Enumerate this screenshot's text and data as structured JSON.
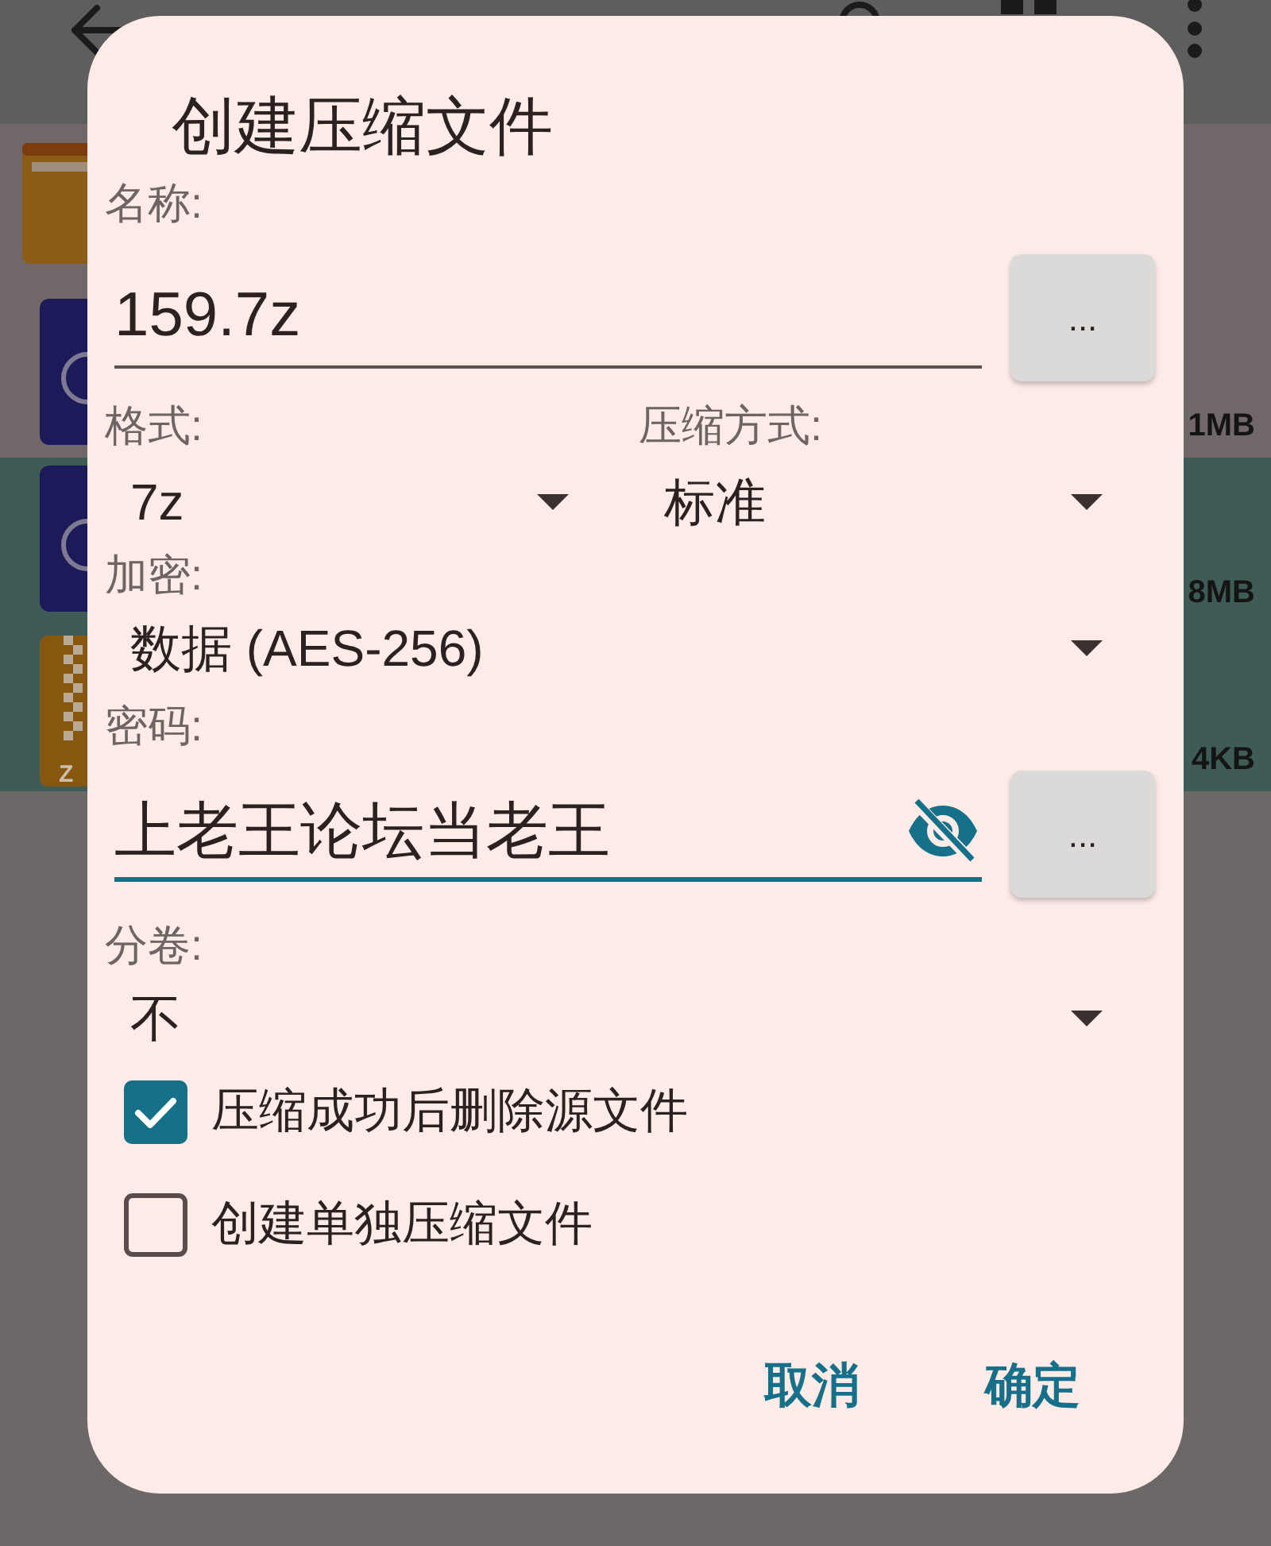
{
  "file_list": [
    {
      "kind": "folder",
      "selected": false
    },
    {
      "kind": "app",
      "size": "1MB",
      "selected": false
    },
    {
      "kind": "app",
      "size": "8MB",
      "selected": true
    },
    {
      "kind": "archive",
      "icon_text": "Z",
      "size": "4KB",
      "selected": true
    }
  ],
  "dialog": {
    "title": "创建压缩文件",
    "rows": [
      {
        "kind": "input",
        "label": "名称:",
        "value": "159.7z",
        "focused": false,
        "button": "..."
      },
      {
        "kind": "select_pair",
        "items": [
          {
            "label": "格式:",
            "value": "7z"
          },
          {
            "label": "压缩方式:",
            "value": "标准"
          }
        ]
      },
      {
        "kind": "select",
        "label": "加密:",
        "value": "数据 (AES-256)"
      },
      {
        "kind": "password",
        "label": "密码:",
        "value": "上老王论坛当老王",
        "focused": true,
        "button": "..."
      },
      {
        "kind": "select",
        "label": "分卷:",
        "value": "不"
      }
    ],
    "options": [
      {
        "label": "压缩成功后删除源文件",
        "checked": true
      },
      {
        "label": "创建单独压缩文件",
        "checked": false
      }
    ],
    "buttons": [
      "取消",
      "确定"
    ]
  }
}
